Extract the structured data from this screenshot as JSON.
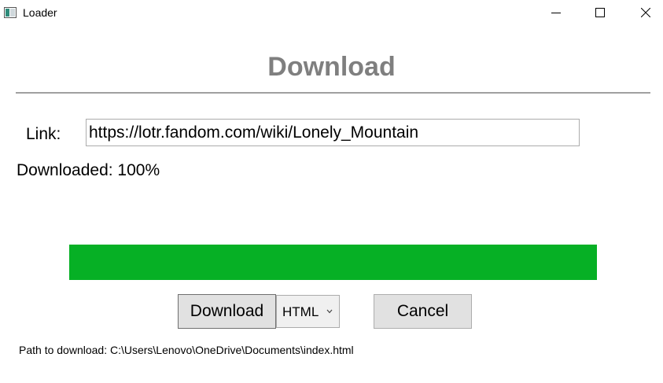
{
  "window": {
    "title": "Loader",
    "icon": "app-window-icon",
    "controls": [
      "minimize-icon",
      "maximize-icon",
      "close-icon"
    ]
  },
  "header": {
    "title": "Download"
  },
  "form": {
    "link_label": "Link:",
    "link_value": "https://lotr.fandom.com/wiki/Lonely_Mountain"
  },
  "status": {
    "text": "Downloaded: 100%"
  },
  "progress": {
    "value_percent": 100,
    "fill_color": "#06b025"
  },
  "actions": {
    "download_label": "Download",
    "format_selected": "HTML",
    "cancel_label": "Cancel"
  },
  "footer": {
    "path_text": "Path to download: C:\\Users\\Lenovo\\OneDrive\\Documents\\index.html"
  }
}
